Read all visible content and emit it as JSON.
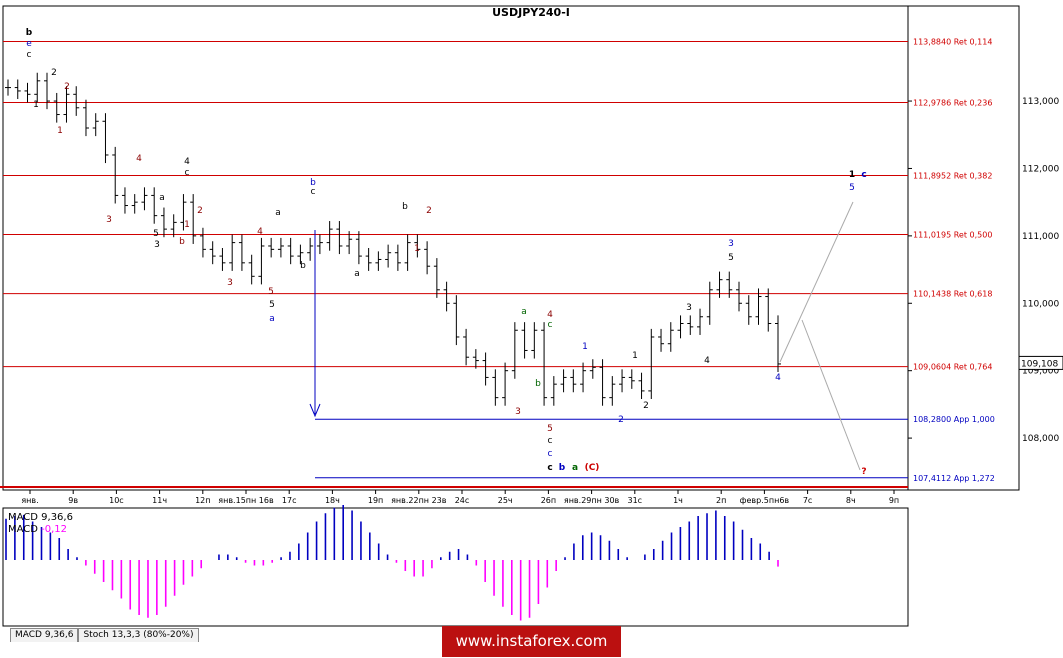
{
  "chart_data": {
    "type": "candlestick",
    "symbol_title": "USDJPY240-I",
    "y_axis": {
      "min": 107.23,
      "max": 114.41,
      "ticks": [
        108.0,
        109.0,
        110.0,
        111.0,
        112.0,
        113.0
      ],
      "tick_labels": [
        "108,000",
        "109,000",
        "110,000",
        "111,000",
        "112,000",
        "113,000"
      ],
      "current_price": 109.108,
      "current_price_label": "109,108"
    },
    "x_axis": {
      "tick_labels": [
        "янв.",
        "9в",
        "10с",
        "11ч",
        "12п",
        "янв.15пн 16в",
        "17с",
        "18ч",
        "19п",
        "янв.22пн 23в",
        "24с",
        "25ч",
        "26п",
        "янв.29пн 30в",
        "31с",
        "1ч",
        "2п",
        "февр.5пн6в",
        "7с",
        "8ч",
        "9п"
      ]
    },
    "levels": [
      {
        "label": "113,8840 Ret 0,114",
        "value": 113.884,
        "color": "#d00000"
      },
      {
        "label": "112,9786 Ret 0,236",
        "value": 112.9786,
        "color": "#d00000"
      },
      {
        "label": "111,8952 Ret 0,382",
        "value": 111.8952,
        "color": "#d00000"
      },
      {
        "label": "111,0195 Ret 0,500",
        "value": 111.0195,
        "color": "#d00000"
      },
      {
        "label": "110,1438 Ret 0,618",
        "value": 110.1438,
        "color": "#d00000"
      },
      {
        "label": "109,0604 Ret 0,764",
        "value": 109.0604,
        "color": "#d00000"
      },
      {
        "label": "108,2800 App 1,000",
        "value": 108.28,
        "color": "#0000c0"
      },
      {
        "label": "107,4112 App 1,272",
        "value": 107.4112,
        "color": "#0000c0"
      }
    ],
    "close_series": [
      113.2,
      113.15,
      113.1,
      113.3,
      113.0,
      112.8,
      113.1,
      112.9,
      112.6,
      112.7,
      112.2,
      111.6,
      111.45,
      111.5,
      111.6,
      111.3,
      111.1,
      111.2,
      111.5,
      111.0,
      110.8,
      110.7,
      110.6,
      110.9,
      110.6,
      110.4,
      110.85,
      110.8,
      110.85,
      110.7,
      110.75,
      110.85,
      110.9,
      111.1,
      110.85,
      110.95,
      110.7,
      110.6,
      110.65,
      110.75,
      110.6,
      110.9,
      110.8,
      110.55,
      110.2,
      110.0,
      109.5,
      109.2,
      109.15,
      108.9,
      108.6,
      109.0,
      109.6,
      109.3,
      109.6,
      108.6,
      108.8,
      108.9,
      108.8,
      109.0,
      109.05,
      108.6,
      108.8,
      108.9,
      108.85,
      108.7,
      109.5,
      109.4,
      109.6,
      109.7,
      109.65,
      109.8,
      110.2,
      110.35,
      110.2,
      110.0,
      109.8,
      110.1,
      109.7,
      109.1
    ],
    "macd": {
      "label": "MACD 9,36,6",
      "value_label": "MACD -0,12",
      "value": -0.12,
      "color": "#0000c0",
      "signal_color": "#ff00ff",
      "values": [
        0.75,
        0.8,
        0.82,
        0.7,
        0.6,
        0.5,
        0.4,
        0.2,
        0.05,
        -0.1,
        -0.25,
        -0.4,
        -0.55,
        -0.7,
        -0.9,
        -1.0,
        -1.05,
        -1.0,
        -0.85,
        -0.65,
        -0.45,
        -0.3,
        -0.15,
        0.0,
        0.1,
        0.1,
        0.05,
        -0.05,
        -0.1,
        -0.1,
        -0.05,
        0.05,
        0.15,
        0.3,
        0.5,
        0.7,
        0.85,
        0.95,
        1.0,
        0.9,
        0.7,
        0.5,
        0.3,
        0.1,
        -0.05,
        -0.2,
        -0.3,
        -0.3,
        -0.15,
        0.05,
        0.15,
        0.2,
        0.1,
        -0.1,
        -0.4,
        -0.65,
        -0.85,
        -1.0,
        -1.1,
        -1.05,
        -0.8,
        -0.5,
        -0.2,
        0.05,
        0.3,
        0.45,
        0.5,
        0.45,
        0.35,
        0.2,
        0.05,
        0.0,
        0.1,
        0.2,
        0.35,
        0.5,
        0.6,
        0.7,
        0.8,
        0.85,
        0.9,
        0.8,
        0.7,
        0.55,
        0.4,
        0.3,
        0.15,
        -0.12
      ]
    },
    "labels_text": {
      "level_c": "c",
      "level_b": "b",
      "level_a": "a",
      "level_C": "(C)",
      "q": "?"
    }
  },
  "tabs": [
    "MACD 9,36,6",
    "Stoch 13,3,3 (80%-20%)"
  ],
  "banner": "www.instaforex.com"
}
